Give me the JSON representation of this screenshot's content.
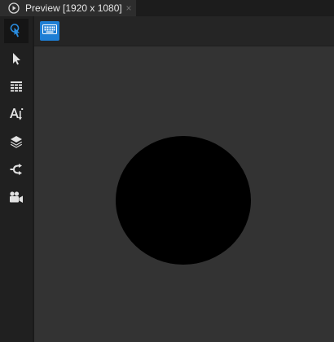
{
  "tab": {
    "title": "Preview [1920 x 1080]",
    "close_glyph": "×",
    "icon": "play-circle-icon"
  },
  "toolrail": {
    "tools": [
      {
        "name": "interaction-pointer",
        "icon": "hand-pointer-icon",
        "active": true
      },
      {
        "name": "select",
        "icon": "arrow-cursor-icon",
        "active": false
      },
      {
        "name": "grid",
        "icon": "grid-icon",
        "active": false
      },
      {
        "name": "text-sort",
        "icon": "text-sort-icon",
        "active": false
      },
      {
        "name": "layers",
        "icon": "layers-icon",
        "active": false
      },
      {
        "name": "connections",
        "icon": "connection-icon",
        "active": false
      },
      {
        "name": "camera",
        "icon": "video-camera-icon",
        "active": false
      }
    ]
  },
  "toolbar": {
    "keyboard_icon": "keyboard-icon"
  },
  "canvas": {
    "shape": "circle",
    "fill": "#000000",
    "background": "#333333"
  },
  "colors": {
    "accent": "#1e7ed4",
    "active_tool_icon": "#2a8de0",
    "icon": "#e2e2e2"
  }
}
